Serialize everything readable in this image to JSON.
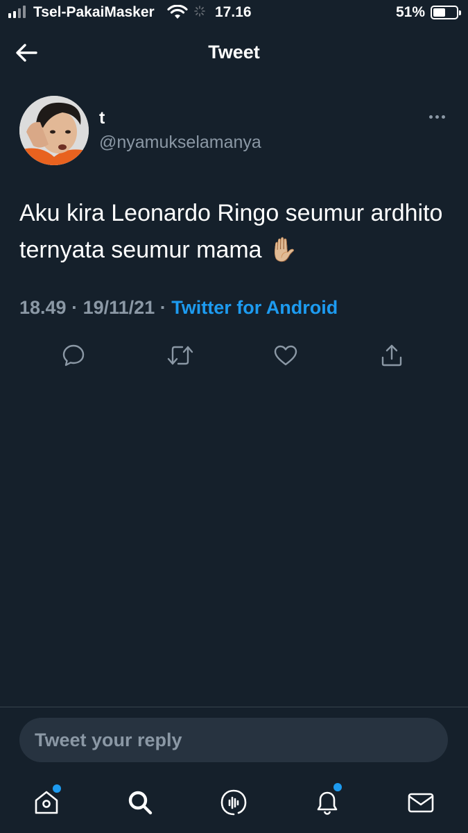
{
  "status_bar": {
    "carrier": "Tsel-PakaiMasker",
    "time": "17.16",
    "battery_percent": "51%",
    "battery_level": 0.51
  },
  "header": {
    "title": "Tweet",
    "back_icon": "arrow-left-icon"
  },
  "tweet": {
    "author": {
      "display_name": "t",
      "handle": "@nyamukselamanya"
    },
    "text": "Aku kira Leonardo Ringo seumur ardhito ternyata seumur mama ✋🏼",
    "time": "18.49",
    "date": "19/11/21",
    "separator": "·",
    "source": "Twitter for Android",
    "actions": [
      {
        "name": "reply",
        "icon": "comment-icon"
      },
      {
        "name": "retweet",
        "icon": "retweet-icon"
      },
      {
        "name": "like",
        "icon": "heart-icon"
      },
      {
        "name": "share",
        "icon": "share-icon"
      }
    ]
  },
  "reply": {
    "placeholder": "Tweet your reply"
  },
  "tab_bar": {
    "tabs": [
      {
        "name": "home",
        "icon": "home-icon",
        "has_badge": true
      },
      {
        "name": "search",
        "icon": "search-icon",
        "has_badge": false
      },
      {
        "name": "spaces",
        "icon": "spaces-icon",
        "has_badge": false
      },
      {
        "name": "notifications",
        "icon": "bell-icon",
        "has_badge": true
      },
      {
        "name": "messages",
        "icon": "mail-icon",
        "has_badge": false
      }
    ]
  },
  "colors": {
    "background": "#15202b",
    "accent": "#1d9bf0",
    "secondary_text": "#8b98a5",
    "divider": "#38444d",
    "input_background": "#273340"
  }
}
